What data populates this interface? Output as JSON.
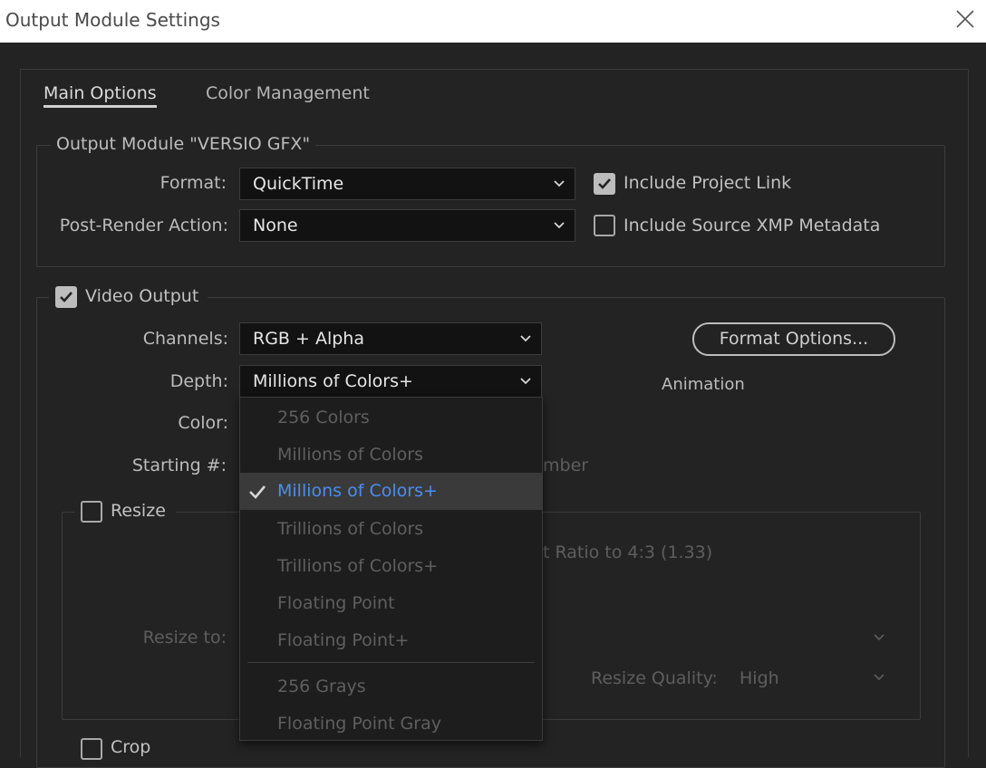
{
  "window": {
    "title": "Output Module Settings"
  },
  "tabs": [
    {
      "label": "Main Options",
      "active": true
    },
    {
      "label": "Color Management",
      "active": false
    }
  ],
  "output_module": {
    "legend": "Output Module \"VERSIO GFX\"",
    "format_label": "Format:",
    "format_value": "QuickTime",
    "post_render_label": "Post-Render Action:",
    "post_render_value": "None",
    "include_project_link": "Include Project Link",
    "include_xmp": "Include Source XMP Metadata"
  },
  "video_output": {
    "label": "Video Output",
    "channels_label": "Channels:",
    "channels_value": "RGB + Alpha",
    "depth_label": "Depth:",
    "depth_value": "Millions of Colors+",
    "color_label": "Color:",
    "starting_label": "Starting #:",
    "starting_partial": "mber",
    "format_options_button": "Format Options...",
    "codec": "Animation"
  },
  "resize": {
    "label": "Resize",
    "aspect_partial": "t Ratio to 4:3 (1.33)",
    "resize_to_label": "Resize to:",
    "quality_label": "Resize Quality:",
    "quality_value": "High"
  },
  "crop": {
    "label": "Crop"
  },
  "depth_dropdown": {
    "items": [
      "256 Colors",
      "Millions of Colors",
      "Millions of Colors+",
      "Trillions of Colors",
      "Trillions of Colors+",
      "Floating Point",
      "Floating Point+",
      "256 Grays",
      "Floating Point Gray"
    ],
    "selected_index": 2
  },
  "colors": {
    "background": "#232323",
    "accent_selected_text": "#4b8ef0"
  }
}
